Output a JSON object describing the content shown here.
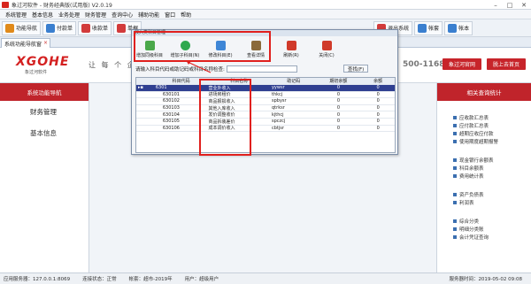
{
  "window": {
    "title": "象过河软件 - 财务经典版(试用版) V2.0.19"
  },
  "menu": [
    "系统管理",
    "基本信息",
    "业务处理",
    "财务管理",
    "查询中心",
    "辅助功能",
    "窗口",
    "帮助"
  ],
  "toolbar": [
    {
      "label": "功能导航",
      "icon": "nav-icon",
      "color": "#e08a1a"
    },
    {
      "label": "付款单",
      "icon": "pay-icon",
      "color": "#3a7fcf"
    },
    {
      "label": "收款单",
      "icon": "receive-icon",
      "color": "#d23b3b"
    },
    {
      "label": "单据",
      "icon": "doc-icon",
      "color": "#d23b3b"
    },
    {
      "label": "凭证",
      "icon": "voucher-icon",
      "color": "#4a9a3a"
    },
    {
      "label": "科目",
      "icon": "subject-icon",
      "color": "#3a7fcf"
    },
    {
      "label": "退出系统",
      "icon": "exit-icon",
      "color": "#d23b3b"
    },
    {
      "label": "帐套",
      "icon": "account-icon",
      "color": "#3a7fcf"
    },
    {
      "label": "帐本",
      "icon": "book-icon",
      "color": "#3a7fcf"
    }
  ],
  "tab": {
    "label": "系统功能导航窗"
  },
  "banner": {
    "brand": "XGOHE",
    "brand_sub": "象过河软件",
    "slogan": "让 每 个 企 业",
    "phone": "500-1168",
    "btn_official": "象过河官网",
    "btn_exit": "脱上去首页"
  },
  "leftnav": {
    "header": "系统功能导航",
    "items": [
      "财务管理",
      "基本信息"
    ]
  },
  "rightpanel": {
    "header": "相关查询统计",
    "groups": [
      [
        "应收款汇总表",
        "应付款汇总表",
        "超期应收应付款",
        "使用期度超期报警"
      ],
      [
        "现金银行余额表",
        "科目余额表",
        "费用统计表"
      ],
      [
        "资产负债表",
        "利润表"
      ],
      [
        "综合分类",
        "明细分类账",
        "会计凭证查询"
      ]
    ]
  },
  "dialog": {
    "title": "收入类科目管理",
    "tools": [
      {
        "label": "增加同级科目",
        "icon": "add-sibling-icon",
        "color": "#4aa84a"
      },
      {
        "label": "增加子科目(N)",
        "icon": "add-child-icon",
        "color": "#2fa84f"
      },
      {
        "label": "修改科目(E)",
        "icon": "edit-icon",
        "color": "#3e86d6"
      },
      {
        "label": "查看详情",
        "icon": "detail-icon",
        "color": "#8a6a3a"
      },
      {
        "label": "刷新(R)",
        "icon": "refresh-icon",
        "color": "#d03a2a"
      },
      {
        "label": "关闭(C)",
        "icon": "close-icon",
        "color": "#d03a2a"
      }
    ],
    "search_label": "请输入科目代码或助记码或科目名称检查:",
    "search_btn": "查找(F)",
    "columns": [
      "",
      "科目代码",
      "科目名称",
      "助记码",
      "期初余额",
      "余额"
    ],
    "rows": [
      {
        "code": "6301",
        "name": "营业外收入",
        "mnemonic": "yywsr",
        "begin": "0",
        "balance": "0",
        "selected": true
      },
      {
        "code": "630101",
        "name": "进场房租价",
        "mnemonic": "thkcj",
        "begin": "0",
        "balance": "0"
      },
      {
        "code": "630102",
        "name": "商品报损收入",
        "mnemonic": "spbysr",
        "begin": "0",
        "balance": "0"
      },
      {
        "code": "630103",
        "name": "其他入库收入",
        "mnemonic": "qtrksr",
        "begin": "0",
        "balance": "0"
      },
      {
        "code": "630104",
        "name": "发价调整收价",
        "mnemonic": "kjthcj",
        "begin": "0",
        "balance": "0"
      },
      {
        "code": "630105",
        "name": "商品拆装差价",
        "mnemonic": "spczcj",
        "begin": "0",
        "balance": "0"
      },
      {
        "code": "630106",
        "name": "成本调价收入",
        "mnemonic": "cbtjsr",
        "begin": "0",
        "balance": "0"
      }
    ]
  },
  "status": {
    "server": "应用服务器：127.0.0.1:8069",
    "conn": "连接状态：正常",
    "account": "帐套：超市-2019年",
    "user": "用户：超级用户",
    "time": "服务器时间：2019-05-02 09:08"
  }
}
